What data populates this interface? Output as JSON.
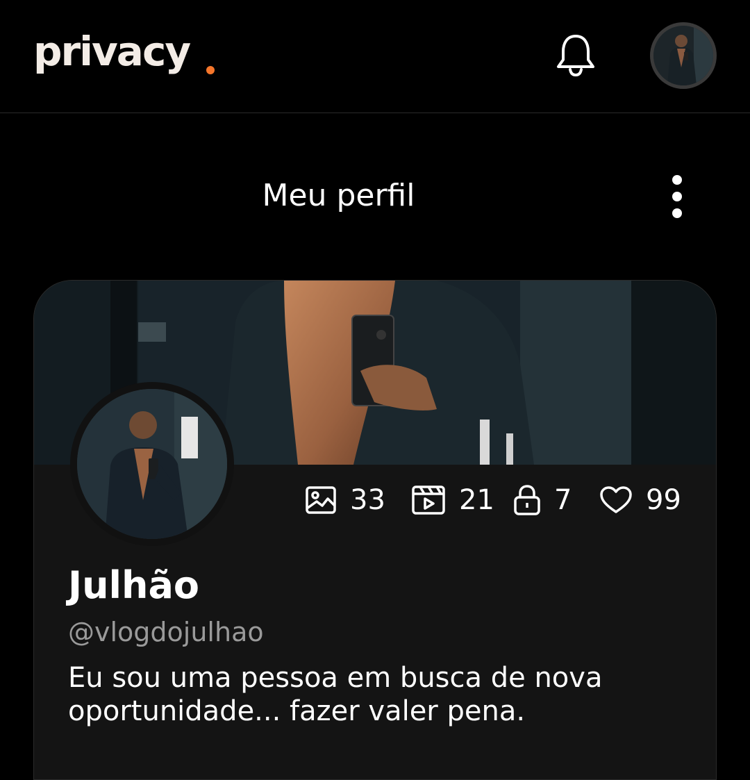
{
  "brand": {
    "logo_text": "privacy",
    "accent_color": "#f5762b"
  },
  "header": {
    "notifications_icon": "bell-icon",
    "account_avatar": "avatar"
  },
  "page": {
    "title": "Meu perfil",
    "menu_icon": "more-vertical-icon"
  },
  "profile": {
    "name": "Julhão",
    "handle": "@vlogdojulhao",
    "bio": "Eu sou uma pessoa em busca de nova oportunidade... fazer valer pena.",
    "stats": {
      "photos": {
        "icon": "image-icon",
        "count": "33"
      },
      "videos": {
        "icon": "video-icon",
        "count": "21"
      },
      "locked": {
        "icon": "lock-icon",
        "count": "7"
      },
      "likes": {
        "icon": "heart-icon",
        "count": "99"
      }
    }
  }
}
